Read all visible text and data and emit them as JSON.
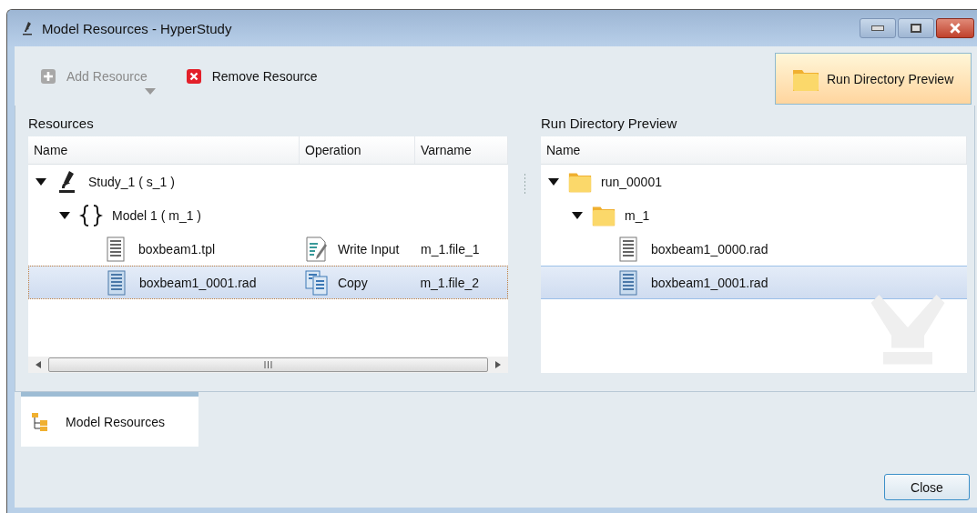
{
  "window": {
    "title": "Model Resources - HyperStudy"
  },
  "toolbar": [
    {
      "kind": "add",
      "label": "Add Resource",
      "disabled": true,
      "has_menu": true
    },
    {
      "kind": "remove",
      "label": "Remove Resource",
      "disabled": false,
      "has_menu": false
    }
  ],
  "preview_button": {
    "label": "Run Directory Preview",
    "on": true
  },
  "resources": {
    "title": "Resources",
    "columns": [
      "Name",
      "Operation",
      "Varname"
    ],
    "rows": [
      {
        "kind": "study",
        "name": "Study_1 ( s_1 )",
        "expanded": true,
        "selected": false,
        "children": [
          {
            "kind": "model",
            "name": "Model 1 ( m_1 )",
            "expanded": true,
            "selected": false,
            "children": [
              {
                "kind": "file",
                "name": "boxbeam1.tpl",
                "operation": {
                  "kind": "write",
                  "label": "Write Input"
                },
                "varname": "m_1.file_1",
                "selected": false
              },
              {
                "kind": "file",
                "name": "boxbeam1_0001.rad",
                "operation": {
                  "kind": "copy",
                  "label": "Copy"
                },
                "varname": "m_1.file_2",
                "selected": true
              }
            ]
          }
        ]
      }
    ]
  },
  "preview": {
    "title": "Run Directory Preview",
    "columns": [
      "Name"
    ],
    "rows": [
      {
        "kind": "folder",
        "name": "run_00001",
        "expanded": true,
        "selected": false,
        "children": [
          {
            "kind": "folder",
            "name": "m_1",
            "expanded": true,
            "selected": false,
            "children": [
              {
                "kind": "file",
                "name": "boxbeam1_0000.rad",
                "selected": false
              },
              {
                "kind": "file",
                "name": "boxbeam1_0001.rad",
                "selected": true
              }
            ]
          }
        ]
      }
    ]
  },
  "tabs": [
    {
      "label": "Model Resources",
      "selected": true
    }
  ],
  "buttons": [
    {
      "label": "Close"
    }
  ]
}
